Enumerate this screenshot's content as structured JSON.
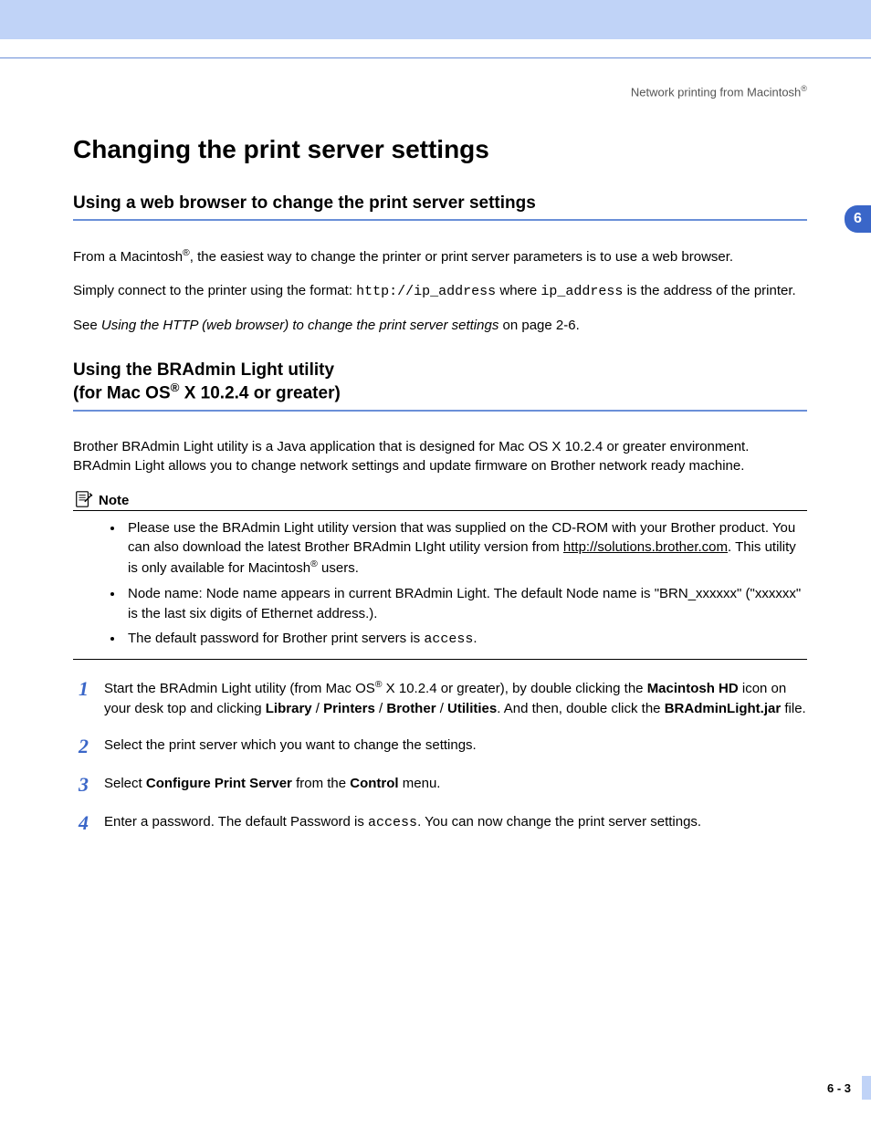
{
  "runningHead": "Network printing from Macintosh",
  "chapterTab": "6",
  "title": "Changing the print server settings",
  "sec1": {
    "heading": "Using a web browser to change the print server settings",
    "p1a": "From a Macintosh",
    "p1b": ", the easiest way to change the printer or print server parameters is to use a web browser.",
    "p2a": "Simply connect to the printer using the format: ",
    "p2code1": "http://ip_address",
    "p2b": " where ",
    "p2code2": "ip_address",
    "p2c": " is the address of the printer.",
    "p3a": "See ",
    "p3i": "Using the HTTP (web browser) to change the print server settings",
    "p3b": " on page 2-6."
  },
  "sec2": {
    "heading_l1": "Using the BRAdmin Light utility",
    "heading_l2a": "(for Mac OS",
    "heading_l2b": " X 10.2.4 or greater)",
    "p1": "Brother BRAdmin Light utility is a Java application that is designed for Mac OS X 10.2.4 or greater environment. BRAdmin Light allows you to change network settings and update firmware on Brother network ready machine."
  },
  "note": {
    "label": "Note",
    "b1a": "Please use the BRAdmin Light utility version that was supplied on the CD-ROM with your Brother product. You can also download the latest Brother BRAdmin LIght utility version from ",
    "b1link": "http://solutions.brother.com",
    "b1b": ". This utility is only available for Macintosh",
    "b1c": " users.",
    "b2": "Node name: Node name appears in current BRAdmin Light. The default Node name is \"BRN_xxxxxx\" (\"xxxxxx\" is the last six digits of Ethernet address.).",
    "b3a": "The default password for Brother print servers is ",
    "b3code": "access",
    "b3b": "."
  },
  "steps": {
    "n1": "1",
    "s1a": "Start the BRAdmin Light utility (from Mac OS",
    "s1b": " X 10.2.4 or greater), by double clicking the ",
    "s1bold1": "Macintosh HD",
    "s1c": " icon on your desk top and clicking ",
    "s1bold2": "Library",
    "s1d": " / ",
    "s1bold3": "Printers",
    "s1e": " / ",
    "s1bold4": "Brother",
    "s1f": " / ",
    "s1bold5": "Utilities",
    "s1g": ". And then, double click the ",
    "s1bold6": "BRAdminLight.jar",
    "s1h": " file.",
    "n2": "2",
    "s2": "Select the print server which you want to change the settings.",
    "n3": "3",
    "s3a": "Select ",
    "s3bold1": "Configure Print Server",
    "s3b": " from the ",
    "s3bold2": "Control",
    "s3c": " menu.",
    "n4": "4",
    "s4a": "Enter a password. The default Password is ",
    "s4code": "access",
    "s4b": ". You can now change the print server settings."
  },
  "pageNumber": "6 - 3"
}
